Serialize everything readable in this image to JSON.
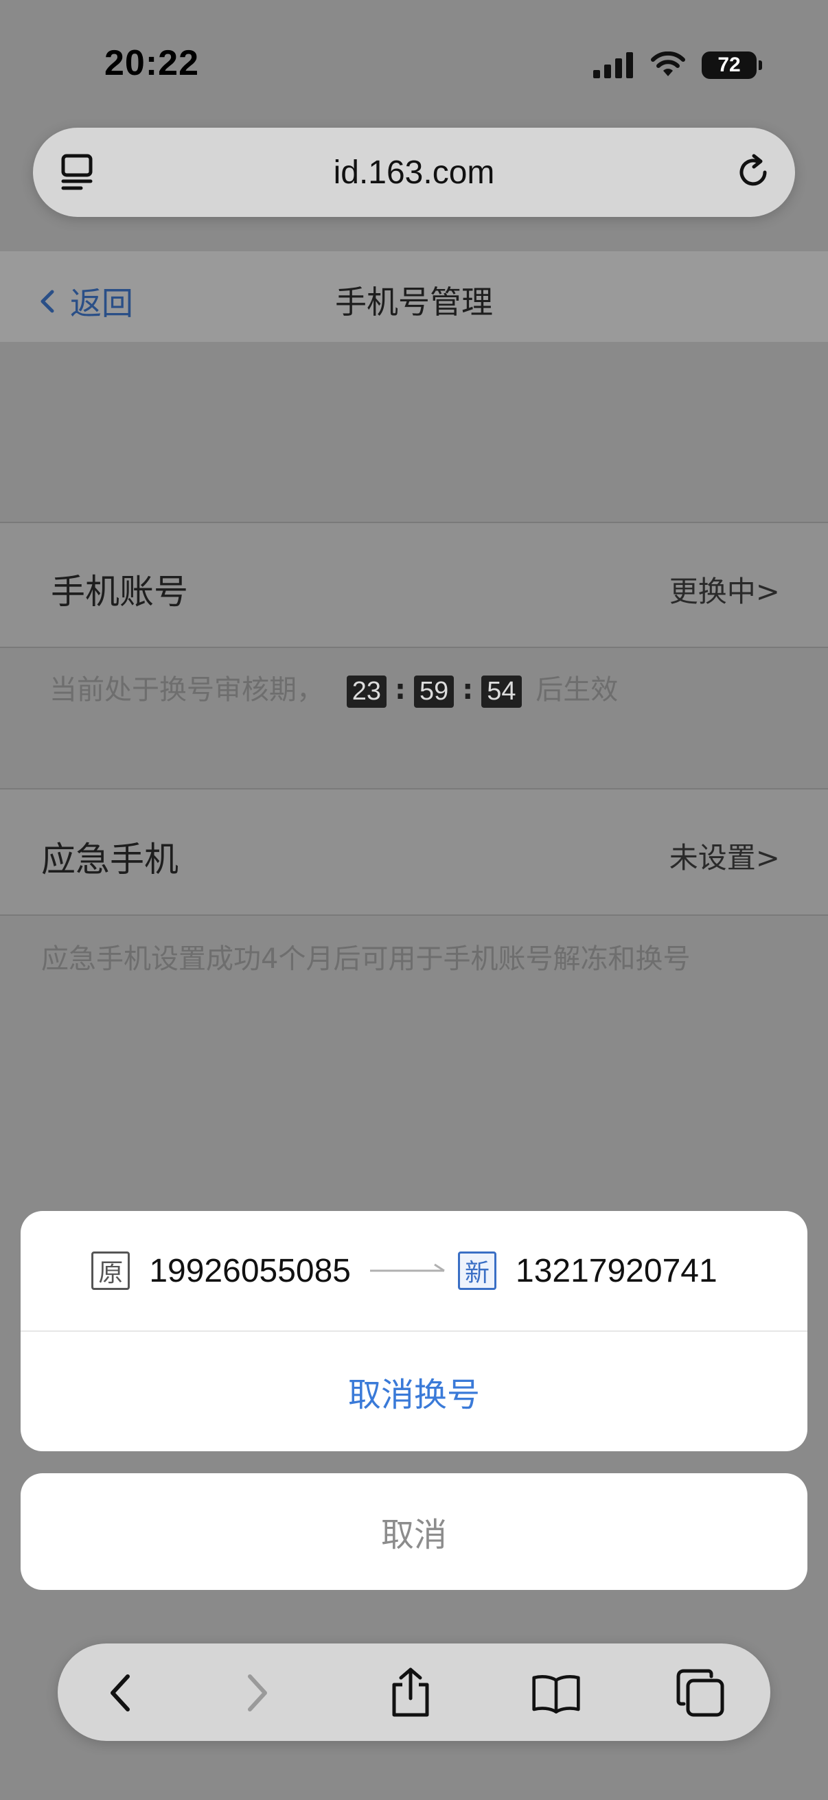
{
  "status_bar": {
    "time": "20:22",
    "battery": "72"
  },
  "browser": {
    "url": "id.163.com",
    "left_icon": "reader-icon",
    "right_icon": "reload-icon"
  },
  "nav": {
    "back_label": "返回",
    "title": "手机号管理"
  },
  "phone_account": {
    "label": "手机账号",
    "value": "更换中>",
    "hint_prefix": "当前处于换号审核期，",
    "timer": [
      "23",
      "59",
      "54"
    ],
    "timer_sep": ":",
    "hint_suffix": "后生效"
  },
  "emergency_phone": {
    "label": "应急手机",
    "value": "未设置>",
    "hint": "应急手机设置成功4个月后可用于手机账号解冻和换号"
  },
  "action_sheet": {
    "old_tag": "原",
    "old_number": "19926055085",
    "new_tag": "新",
    "new_number": "13217920741",
    "action_label": "取消换号",
    "cancel_label": "取消"
  },
  "colors": {
    "link": "#2a4f87",
    "action": "#3a7ad8",
    "new_tag": "#3a6fc5"
  }
}
